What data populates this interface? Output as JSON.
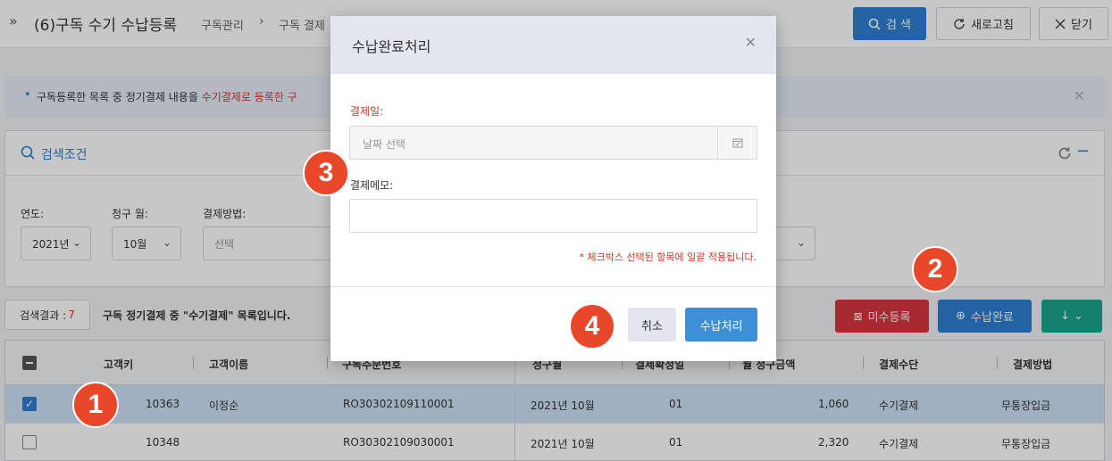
{
  "header": {
    "expand_icon": "»",
    "title": "(6)구독 수기 수납등록",
    "breadcrumb": [
      "구독관리",
      "구독 결제"
    ],
    "breadcrumb_sep": "›",
    "buttons": {
      "search": "검 색",
      "refresh": "새로고침",
      "close": "닫기"
    }
  },
  "notice": {
    "text_before": "구독등록한 목록 중 정기결제 내용을",
    "text_highlight": "수기결제로 등록한 구",
    "close": "✕"
  },
  "search_panel": {
    "title": "검색조건",
    "fields": [
      {
        "label": "연도:",
        "value": "2021년"
      },
      {
        "label": "청구 월:",
        "value": "10월"
      },
      {
        "label": "결제방법:",
        "value": "선택"
      }
    ]
  },
  "results": {
    "count_label": "검색결과 :",
    "count": "7",
    "description": "구독 정기결제 중 \"수기결제\" 목록입니다.",
    "buttons": {
      "unpaid": "미수등록",
      "paid": "수납완료",
      "download": "↓  ⌄"
    }
  },
  "table": {
    "columns": [
      "고객키",
      "고객이름",
      "구독주문번호",
      "청구월",
      "결제확정일",
      "월 청구금액",
      "결제수단",
      "결제방법"
    ],
    "rows": [
      {
        "checked": true,
        "key": "10363",
        "name": "이정순",
        "order": "RO30302109110001",
        "month": "2021년 10월",
        "day": "01",
        "amount": "1,060",
        "means": "수기결제",
        "method": "무통장입금"
      },
      {
        "checked": false,
        "key": "10348",
        "name": "",
        "order": "RO30302109030001",
        "month": "2021년 10월",
        "day": "01",
        "amount": "2,320",
        "means": "수기결제",
        "method": "무통장입금"
      }
    ]
  },
  "modal": {
    "title": "수납완료처리",
    "close": "✕",
    "date_label": "결제일:",
    "date_placeholder": "날짜 선택",
    "memo_label": "결제메모:",
    "memo_value": "",
    "note": "* 체크박스 선택된 항목에 일괄 적용됩니다.",
    "cancel": "취소",
    "submit": "수납처리"
  },
  "steps": [
    "1",
    "2",
    "3",
    "4"
  ],
  "colors": {
    "primary": "#2e7fd3",
    "danger": "#d7373f",
    "teal": "#1aa68f",
    "step": "#e8472a"
  }
}
